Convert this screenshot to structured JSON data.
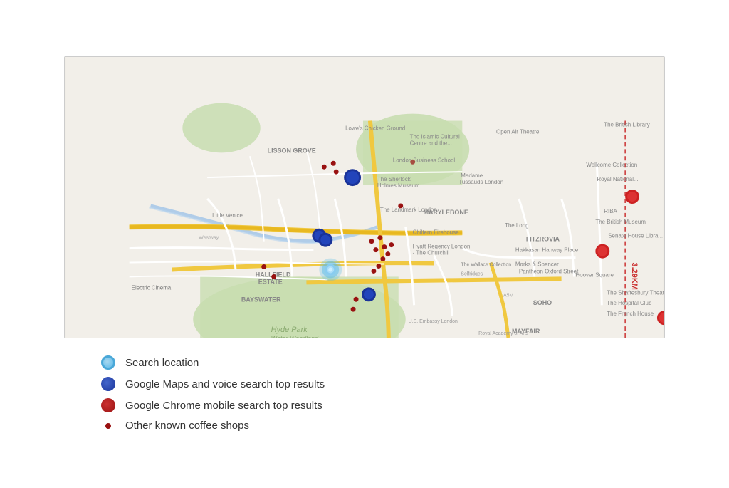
{
  "map": {
    "alt": "London map showing coffee shop search results"
  },
  "legend": {
    "items": [
      {
        "id": "search-location",
        "type": "search",
        "label": "Search location"
      },
      {
        "id": "google-maps-results",
        "type": "google-maps",
        "label": "Google Maps and voice search top results"
      },
      {
        "id": "chrome-results",
        "type": "chrome",
        "label": "Google Chrome mobile search top results"
      },
      {
        "id": "other-coffee",
        "type": "other",
        "label": "Other known coffee shops"
      }
    ]
  }
}
